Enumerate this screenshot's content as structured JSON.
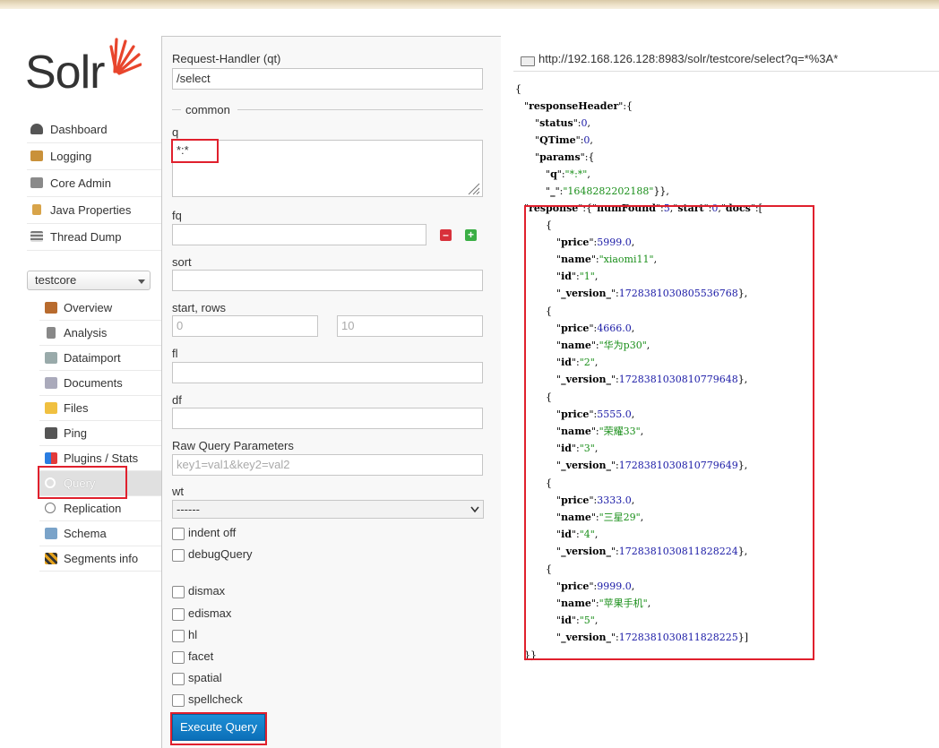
{
  "logo": {
    "text": "Solr"
  },
  "nav": {
    "items": [
      {
        "label": "Dashboard",
        "icon": "dashboard-icon"
      },
      {
        "label": "Logging",
        "icon": "logging-icon"
      },
      {
        "label": "Core Admin",
        "icon": "core-admin-icon"
      },
      {
        "label": "Java Properties",
        "icon": "java-properties-icon"
      },
      {
        "label": "Thread Dump",
        "icon": "thread-dump-icon"
      }
    ],
    "core_selector": "testcore",
    "core_items": [
      {
        "label": "Overview",
        "icon": "overview-icon"
      },
      {
        "label": "Analysis",
        "icon": "analysis-icon"
      },
      {
        "label": "Dataimport",
        "icon": "dataimport-icon"
      },
      {
        "label": "Documents",
        "icon": "documents-icon"
      },
      {
        "label": "Files",
        "icon": "files-icon"
      },
      {
        "label": "Ping",
        "icon": "ping-icon"
      },
      {
        "label": "Plugins / Stats",
        "icon": "plugins-icon"
      },
      {
        "label": "Query",
        "icon": "query-icon"
      },
      {
        "label": "Replication",
        "icon": "replication-icon"
      },
      {
        "label": "Schema",
        "icon": "schema-icon"
      },
      {
        "label": "Segments info",
        "icon": "segments-icon"
      }
    ]
  },
  "form": {
    "request_handler_label": "Request-Handler (qt)",
    "request_handler_value": "/select",
    "common_label": "common",
    "q_label": "q",
    "q_value": "*:*",
    "fq_label": "fq",
    "fq_value": "",
    "sort_label": "sort",
    "sort_value": "",
    "start_rows_label": "start, rows",
    "start_placeholder": "0",
    "rows_placeholder": "10",
    "fl_label": "fl",
    "df_label": "df",
    "raw_label": "Raw Query Parameters",
    "raw_placeholder": "key1=val1&key2=val2",
    "wt_label": "wt",
    "wt_value": "------",
    "checkboxes": [
      "indent off",
      "debugQuery",
      "dismax",
      "edismax",
      "hl",
      "facet",
      "spatial",
      "spellcheck"
    ],
    "execute_label": "Execute Query"
  },
  "result": {
    "url": "http://192.168.126.128:8983/solr/testcore/select?q=*%3A*",
    "responseHeader": {
      "status": "0",
      "QTime": "0",
      "q": "\"*:*\"",
      "underscore": "\"1648282202188\""
    },
    "response": {
      "numFound": "5",
      "start": "0"
    },
    "docs": [
      {
        "price": "5999.0",
        "name": "\"xiaomi11\"",
        "id": "\"1\"",
        "version": "1728381030805536768"
      },
      {
        "price": "4666.0",
        "name": "\"华为p30\"",
        "id": "\"2\"",
        "version": "1728381030810779648"
      },
      {
        "price": "5555.0",
        "name": "\"荣耀33\"",
        "id": "\"3\"",
        "version": "1728381030810779649"
      },
      {
        "price": "3333.0",
        "name": "\"三星29\"",
        "id": "\"4\"",
        "version": "1728381030811828224"
      },
      {
        "price": "9999.0",
        "name": "\"苹果手机\"",
        "id": "\"5\"",
        "version": "1728381030811828225"
      }
    ]
  }
}
